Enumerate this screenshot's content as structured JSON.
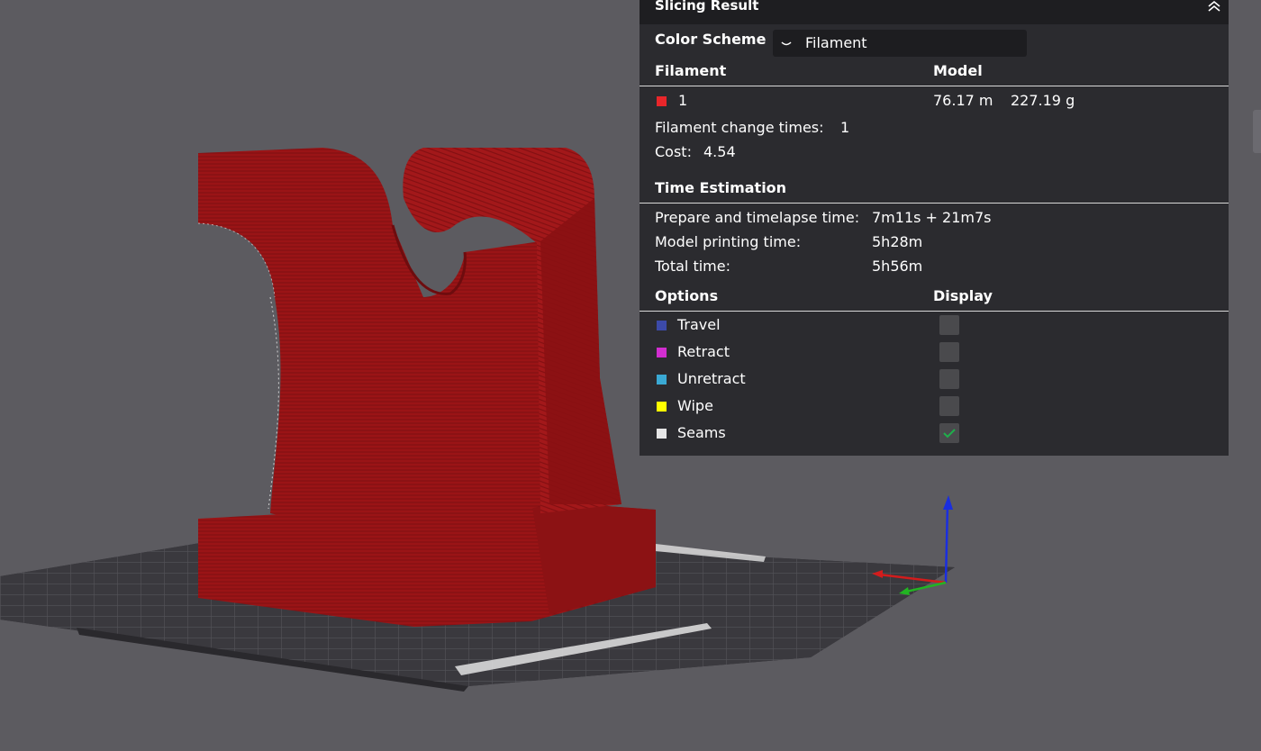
{
  "panel": {
    "title": "Slicing Result",
    "color_scheme": {
      "label": "Color Scheme",
      "value": "Filament"
    },
    "filament": {
      "header_left": "Filament",
      "header_right": "Model",
      "id": "1",
      "length": "76.17 m",
      "weight": "227.19 g",
      "swatch_color": "#e8262a",
      "change_label": "Filament change times:",
      "change_value": "1",
      "cost_label": "Cost:",
      "cost_value": "4.54"
    },
    "time": {
      "header": "Time Estimation",
      "prepare_label": "Prepare and timelapse time:",
      "prepare_value": "7m11s + 21m7s",
      "model_label": "Model printing time:",
      "model_value": "5h28m",
      "total_label": "Total time:",
      "total_value": "5h56m"
    },
    "options": {
      "header_left": "Options",
      "header_right": "Display",
      "items": [
        {
          "label": "Travel",
          "color": "#3c4aa8",
          "checked": false
        },
        {
          "label": "Retract",
          "color": "#d22ed0",
          "checked": false
        },
        {
          "label": "Unretract",
          "color": "#3aa9d4",
          "checked": false
        },
        {
          "label": "Wipe",
          "color": "#ffff00",
          "checked": false
        },
        {
          "label": "Seams",
          "color": "#e6e6e6",
          "checked": true
        }
      ]
    }
  },
  "viewport": {
    "model_color": "#9b1416",
    "bed_color": "#3d3c41",
    "axis_colors": {
      "x": "#d21c1c",
      "y": "#22b422",
      "z": "#1a2ee0"
    }
  }
}
